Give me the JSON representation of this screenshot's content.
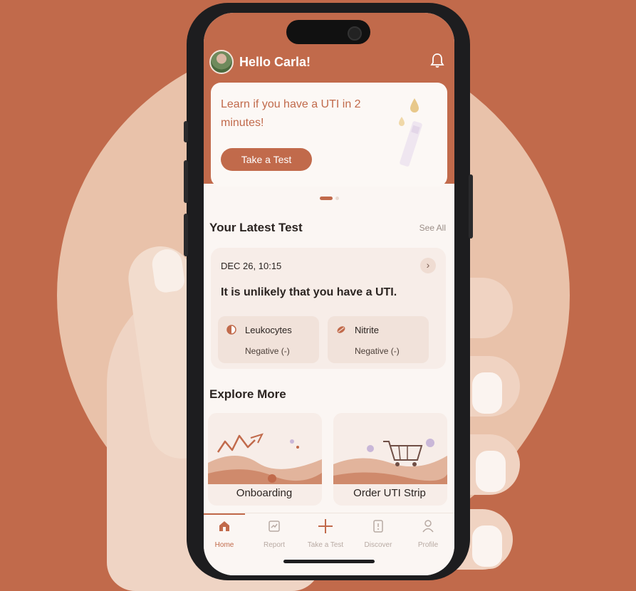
{
  "header": {
    "greeting": "Hello Carla!"
  },
  "promo": {
    "text": "Learn if you have a UTI in 2 minutes!",
    "button_label": "Take a Test"
  },
  "latest_test": {
    "section_title": "Your Latest Test",
    "see_all": "See All",
    "date": "DEC 26, 10:15",
    "result": "It is unlikely that you have a UTI.",
    "markers": [
      {
        "name": "Leukocytes",
        "value": "Negative (-)"
      },
      {
        "name": "Nitrite",
        "value": "Negative (-)"
      }
    ]
  },
  "explore": {
    "section_title": "Explore More",
    "cards": [
      {
        "label": "Onboarding"
      },
      {
        "label": "Order UTI Strip"
      }
    ]
  },
  "tabbar": {
    "items": [
      {
        "label": "Home",
        "icon": "home-icon",
        "active": true
      },
      {
        "label": "Report",
        "icon": "report-icon",
        "active": false
      },
      {
        "label": "Take a Test",
        "icon": "plus-icon",
        "active": false
      },
      {
        "label": "Discover",
        "icon": "discover-icon",
        "active": false
      },
      {
        "label": "Profile",
        "icon": "profile-icon",
        "active": false
      }
    ]
  },
  "colors": {
    "brand": "#c16a4b",
    "background_circle": "#e9c2aa",
    "card": "#f7ede8"
  }
}
